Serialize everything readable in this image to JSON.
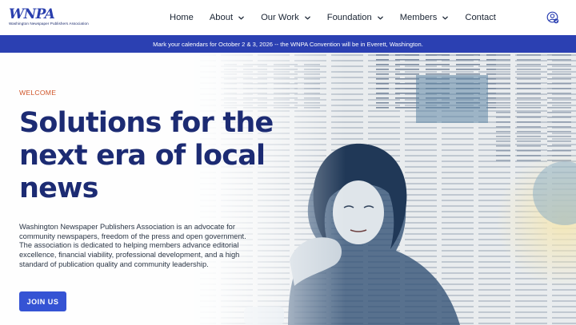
{
  "header": {
    "logo_text": "WNPA",
    "logo_subtitle": "Washington Newspaper Publishers Association",
    "nav": [
      {
        "label": "Home",
        "has_dropdown": false
      },
      {
        "label": "About",
        "has_dropdown": true
      },
      {
        "label": "Our Work",
        "has_dropdown": true
      },
      {
        "label": "Foundation",
        "has_dropdown": true
      },
      {
        "label": "Members",
        "has_dropdown": true
      },
      {
        "label": "Contact",
        "has_dropdown": false
      }
    ],
    "account_icon": "user-circle-icon"
  },
  "announcement": {
    "text": "Mark your calendars for October 2 & 3, 2026 -- the WNPA Convention will be in Everett, Washington."
  },
  "hero": {
    "eyebrow": "WELCOME",
    "headline": "Solutions for the next era of local news",
    "body": "Washington Newspaper Publishers Association is an advocate for community newspapers, freedom of the press and open government. The association is dedicated to helping members advance editorial excellence, financial viability, professional development, and a high standard of publication quality and community leadership.",
    "cta_label": "JOIN US",
    "image_subject": "illustration of a woman resting her chin on her hand in front of a collage of newspaper pages"
  },
  "colors": {
    "brand_blue": "#2b40b2",
    "headline_navy": "#1c2b73",
    "eyebrow_orange": "#d0562a",
    "button_blue": "#3553d4"
  }
}
